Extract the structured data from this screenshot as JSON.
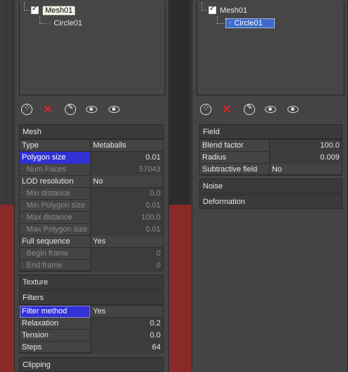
{
  "left": {
    "tree": {
      "root_label": "Mesh01",
      "child_label": "Circle01"
    },
    "mesh_section": {
      "title": "Mesh",
      "rows": [
        {
          "name": "Type",
          "value": "Metaballs",
          "kind": "txt"
        },
        {
          "name": "Polygon size",
          "value": "0.01",
          "kind": "num",
          "highlight": true
        },
        {
          "name": "Num Faces",
          "value": "57043",
          "kind": "num",
          "sub": true,
          "disabled": true
        },
        {
          "name": "LOD resolution",
          "value": "No",
          "kind": "txt"
        },
        {
          "name": "Min distance",
          "value": "0.0",
          "kind": "num",
          "sub": true,
          "disabled": true
        },
        {
          "name": "Min Polygon size",
          "value": "0.01",
          "kind": "num",
          "sub": true,
          "disabled": true
        },
        {
          "name": "Max distance",
          "value": "100.0",
          "kind": "num",
          "sub": true,
          "disabled": true
        },
        {
          "name": "Max Polygon size",
          "value": "0.01",
          "kind": "num",
          "sub": true,
          "disabled": true
        },
        {
          "name": "Full sequence",
          "value": "Yes",
          "kind": "txt"
        },
        {
          "name": "Begin frame",
          "value": "0",
          "kind": "num",
          "sub": true,
          "disabled": true
        },
        {
          "name": "End frame",
          "value": "0",
          "kind": "num",
          "sub": true,
          "disabled": true
        }
      ]
    },
    "texture_title": "Texture",
    "filters_section": {
      "title": "Filters",
      "rows": [
        {
          "name": "Filter method",
          "value": "Yes",
          "kind": "txt",
          "highlight": true
        },
        {
          "name": "Relaxation",
          "value": "0.2",
          "kind": "num"
        },
        {
          "name": "Tension",
          "value": "0.0",
          "kind": "num"
        },
        {
          "name": "Steps",
          "value": "64",
          "kind": "num"
        }
      ]
    },
    "clipping_title": "Clipping"
  },
  "right": {
    "tree": {
      "root_label": "Mesh01",
      "child_label": "Circle01"
    },
    "field_section": {
      "title": "Field",
      "rows": [
        {
          "name": "Blend factor",
          "value": "100.0",
          "kind": "num"
        },
        {
          "name": "Radius",
          "value": "0.009",
          "kind": "num"
        },
        {
          "name": "Subtractive field",
          "value": "No",
          "kind": "txt"
        }
      ]
    },
    "noise_title": "Noise",
    "deformation_title": "Deformation"
  },
  "toolbar_icons": [
    "particle-icon",
    "delete-icon",
    "paint-icon",
    "eye-icon",
    "eye-arrow-icon"
  ],
  "colors": {
    "selection_blue": "#3131d6",
    "tree_selection_blue": "#3d6bc8",
    "delete_red": "#d22222",
    "backdrop_red": "#8a2a28"
  }
}
